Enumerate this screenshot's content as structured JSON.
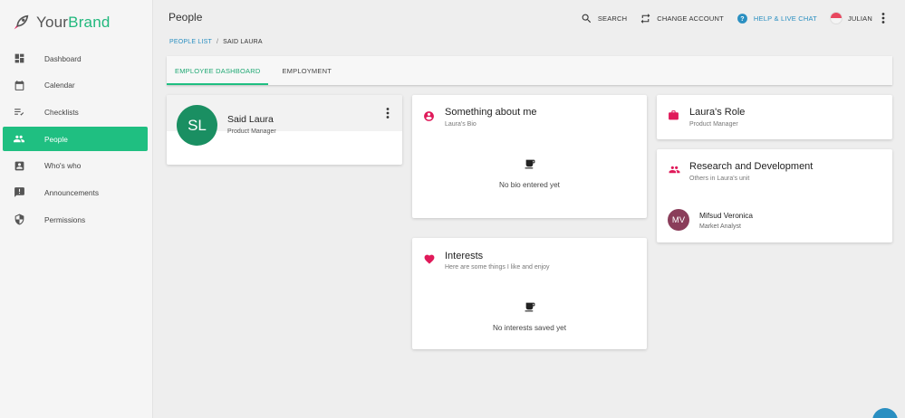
{
  "brand": {
    "name_part1": "Your",
    "name_part2": "Brand"
  },
  "sidebar": {
    "items": [
      {
        "label": "Dashboard",
        "icon": "dashboard-icon"
      },
      {
        "label": "Calendar",
        "icon": "calendar-icon"
      },
      {
        "label": "Checklists",
        "icon": "checklist-icon"
      },
      {
        "label": "People",
        "icon": "people-icon",
        "active": true
      },
      {
        "label": "Who's who",
        "icon": "contact-card-icon"
      },
      {
        "label": "Announcements",
        "icon": "announcement-icon"
      },
      {
        "label": "Permissions",
        "icon": "shield-icon"
      }
    ]
  },
  "header": {
    "title": "People",
    "search_label": "SEARCH",
    "change_account_label": "CHANGE ACCOUNT",
    "help_label": "HELP & LIVE CHAT",
    "user_label": "JULIAN"
  },
  "breadcrumb": {
    "parent": "PEOPLE LIST",
    "separator": "/",
    "current": "SAID LAURA"
  },
  "tabs": [
    {
      "label": "EMPLOYEE DASHBOARD",
      "active": true
    },
    {
      "label": "EMPLOYMENT",
      "active": false
    }
  ],
  "profile": {
    "initials": "SL",
    "name": "Said Laura",
    "role": "Product Manager"
  },
  "about": {
    "title": "Something about me",
    "subtitle": "Laura's Bio",
    "empty_text": "No bio entered yet"
  },
  "interests": {
    "title": "Interests",
    "subtitle": "Here are some things I like and enjoy",
    "empty_text": "No interests saved yet"
  },
  "role_card": {
    "title": "Laura's Role",
    "subtitle": "Product Manager"
  },
  "unit": {
    "title": "Research and Development",
    "subtitle": "Others in Laura's unit",
    "members": [
      {
        "initials": "MV",
        "name": "Mifsud Veronica",
        "role": "Market Analyst"
      }
    ]
  },
  "colors": {
    "accent": "#1fbf81",
    "pink": "#e01a5a",
    "link": "#2a8fc1",
    "avatar_green": "#1a8f62",
    "avatar_plum": "#8a3d5a"
  }
}
